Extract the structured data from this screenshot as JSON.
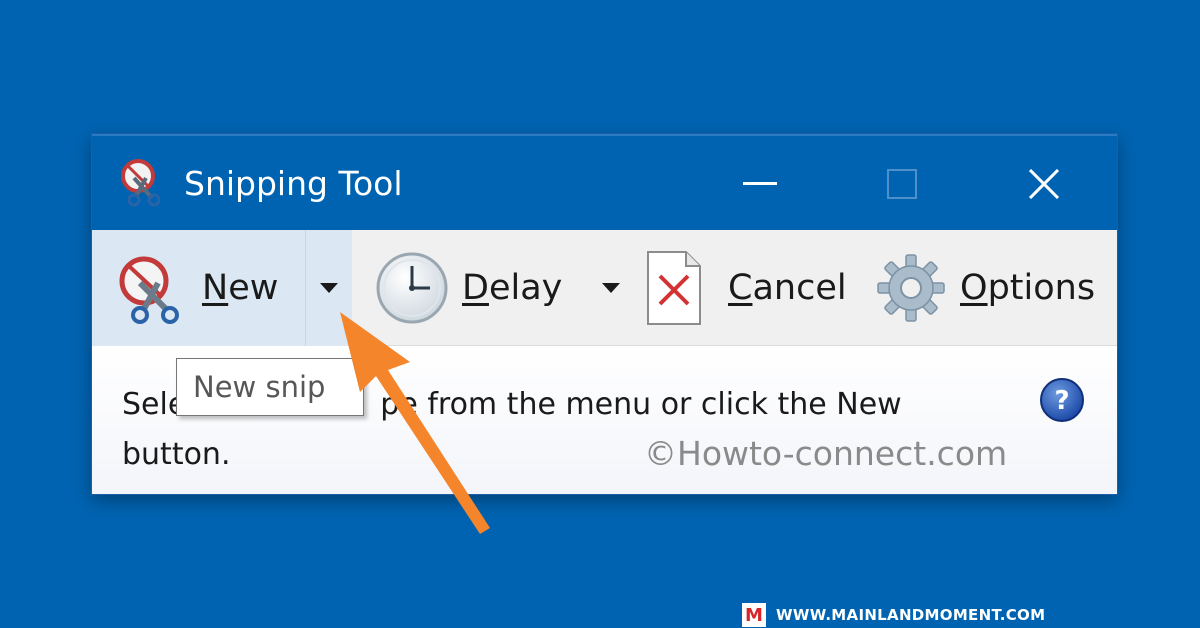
{
  "window": {
    "title": "Snipping Tool",
    "title_icon": "scissors-icon"
  },
  "window_controls": {
    "minimize_icon": "minimize-icon",
    "maximize_icon": "maximize-icon",
    "close_icon": "close-icon"
  },
  "toolbar": {
    "new": {
      "mnemonic": "N",
      "rest": "ew",
      "icon": "snip-scissors-icon"
    },
    "new_dropdown_icon": "chevron-down-icon",
    "delay": {
      "mnemonic": "D",
      "rest": "elay",
      "icon": "clock-icon"
    },
    "delay_dropdown_icon": "chevron-down-icon",
    "cancel": {
      "mnemonic": "C",
      "rest": "ancel",
      "icon": "cancel-document-icon"
    },
    "options": {
      "mnemonic": "O",
      "rest": "ptions",
      "icon": "gear-icon"
    }
  },
  "status": {
    "line1_start": "Sele",
    "line1_end": "pe from the menu or click the New",
    "line2": "button.",
    "help_icon": "help-icon"
  },
  "tooltip": {
    "text": "New snip"
  },
  "watermark": "©Howto-connect.com",
  "footer": {
    "logo_letter": "M",
    "text": "WWW.MAINLANDMOMENT.COM"
  },
  "colors": {
    "desktop": "#0063b1",
    "titlebar": "#0063b1",
    "toolbar": "#f0f0f0",
    "new_button_hover": "#dbe8f4",
    "annotation_arrow": "#f5852a",
    "footer_logo": "#d7262a"
  }
}
